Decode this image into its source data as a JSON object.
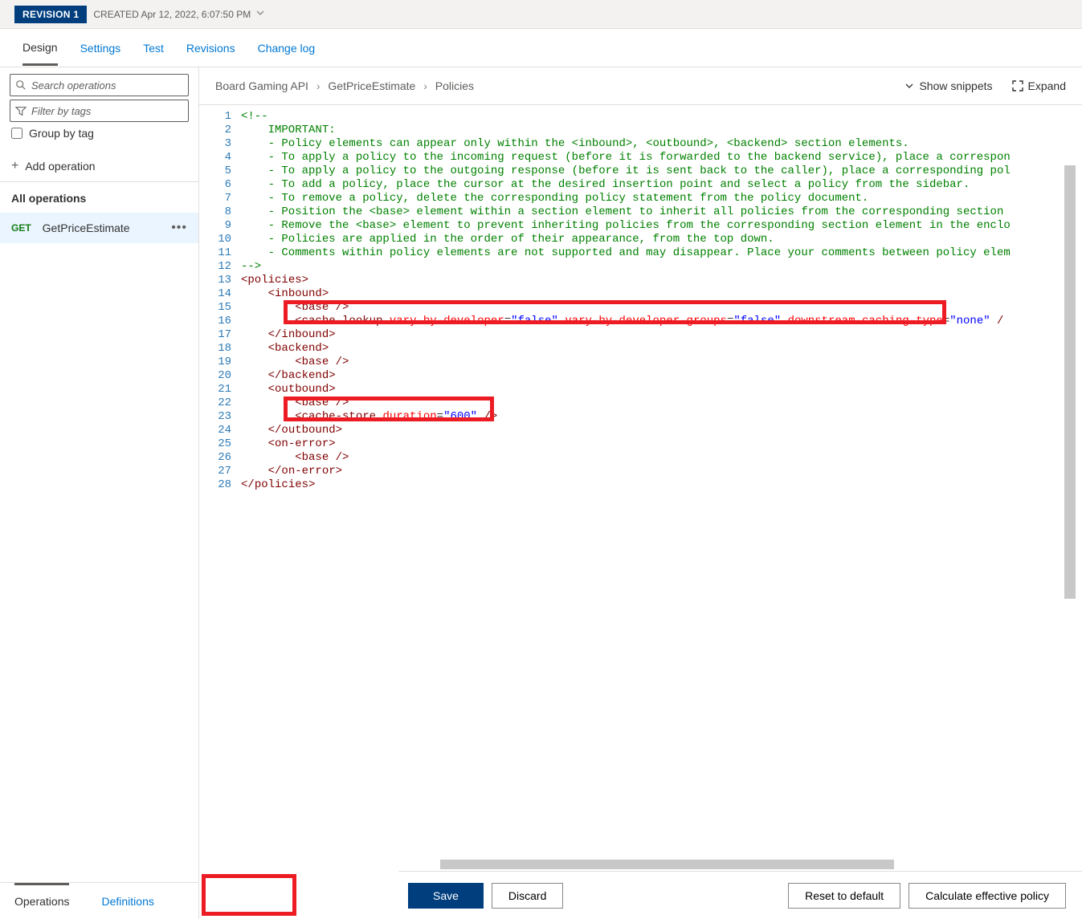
{
  "revision": {
    "badge": "REVISION 1",
    "created_label": "CREATED",
    "created_at": "Apr 12, 2022, 6:07:50 PM"
  },
  "top_tabs": [
    "Design",
    "Settings",
    "Test",
    "Revisions",
    "Change log"
  ],
  "top_tab_active": 0,
  "left": {
    "search_placeholder": "Search operations",
    "filter_placeholder": "Filter by tags",
    "group_by_tag": "Group by tag",
    "add_operation": "Add operation",
    "all_operations": "All operations",
    "operation": {
      "method": "GET",
      "name": "GetPriceEstimate"
    },
    "bottom_tabs": [
      "Operations",
      "Definitions"
    ],
    "bottom_active": 0
  },
  "breadcrumb": [
    "Board Gaming API",
    "GetPriceEstimate",
    "Policies"
  ],
  "right_actions": {
    "show_snippets": "Show snippets",
    "expand": "Expand"
  },
  "code_lines": [
    {
      "n": 1,
      "segs": [
        {
          "c": "cm",
          "t": "<!--"
        }
      ]
    },
    {
      "n": 2,
      "segs": [
        {
          "c": "cm",
          "t": "    IMPORTANT:"
        }
      ]
    },
    {
      "n": 3,
      "segs": [
        {
          "c": "cm",
          "t": "    - Policy elements can appear only within the <inbound>, <outbound>, <backend> section elements."
        }
      ]
    },
    {
      "n": 4,
      "segs": [
        {
          "c": "cm",
          "t": "    - To apply a policy to the incoming request (before it is forwarded to the backend service), place a correspon"
        }
      ]
    },
    {
      "n": 5,
      "segs": [
        {
          "c": "cm",
          "t": "    - To apply a policy to the outgoing response (before it is sent back to the caller), place a corresponding pol"
        }
      ]
    },
    {
      "n": 6,
      "segs": [
        {
          "c": "cm",
          "t": "    - To add a policy, place the cursor at the desired insertion point and select a policy from the sidebar."
        }
      ]
    },
    {
      "n": 7,
      "segs": [
        {
          "c": "cm",
          "t": "    - To remove a policy, delete the corresponding policy statement from the policy document."
        }
      ]
    },
    {
      "n": 8,
      "segs": [
        {
          "c": "cm",
          "t": "    - Position the <base> element within a section element to inherit all policies from the corresponding section "
        }
      ]
    },
    {
      "n": 9,
      "segs": [
        {
          "c": "cm",
          "t": "    - Remove the <base> element to prevent inheriting policies from the corresponding section element in the enclo"
        }
      ]
    },
    {
      "n": 10,
      "segs": [
        {
          "c": "cm",
          "t": "    - Policies are applied in the order of their appearance, from the top down."
        }
      ]
    },
    {
      "n": 11,
      "segs": [
        {
          "c": "cm",
          "t": "    - Comments within policy elements are not supported and may disappear. Place your comments between policy elem"
        }
      ]
    },
    {
      "n": 12,
      "segs": [
        {
          "c": "cm",
          "t": "-->"
        }
      ]
    },
    {
      "n": 13,
      "segs": [
        {
          "c": "tag-p",
          "t": "<"
        },
        {
          "c": "tag-n",
          "t": "policies"
        },
        {
          "c": "tag-p",
          "t": ">"
        }
      ]
    },
    {
      "n": 14,
      "segs": [
        {
          "t": "    "
        },
        {
          "c": "tag-p",
          "t": "<"
        },
        {
          "c": "tag-n",
          "t": "inbound"
        },
        {
          "c": "tag-p",
          "t": ">"
        }
      ]
    },
    {
      "n": 15,
      "segs": [
        {
          "t": "        "
        },
        {
          "c": "tag-p",
          "t": "<"
        },
        {
          "c": "tag-n",
          "t": "base"
        },
        {
          "t": " "
        },
        {
          "c": "tag-p",
          "t": "/>"
        }
      ]
    },
    {
      "n": 16,
      "segs": [
        {
          "t": "        "
        },
        {
          "c": "tag-p",
          "t": "<"
        },
        {
          "c": "tag-n",
          "t": "cache-lookup"
        },
        {
          "t": " "
        },
        {
          "c": "attr-n",
          "t": "vary-by-developer"
        },
        {
          "c": "eq",
          "t": "="
        },
        {
          "c": "attr-v",
          "t": "\"false\""
        },
        {
          "t": " "
        },
        {
          "c": "attr-n",
          "t": "vary-by-developer-groups"
        },
        {
          "c": "eq",
          "t": "="
        },
        {
          "c": "attr-v",
          "t": "\"false\""
        },
        {
          "t": " "
        },
        {
          "c": "attr-n",
          "t": "downstream-caching-type"
        },
        {
          "c": "eq",
          "t": "="
        },
        {
          "c": "attr-v",
          "t": "\"none\""
        },
        {
          "t": " "
        },
        {
          "c": "tag-p",
          "t": "/"
        }
      ]
    },
    {
      "n": 17,
      "segs": [
        {
          "t": "    "
        },
        {
          "c": "tag-p",
          "t": "</"
        },
        {
          "c": "tag-n",
          "t": "inbound"
        },
        {
          "c": "tag-p",
          "t": ">"
        }
      ]
    },
    {
      "n": 18,
      "segs": [
        {
          "t": "    "
        },
        {
          "c": "tag-p",
          "t": "<"
        },
        {
          "c": "tag-n",
          "t": "backend"
        },
        {
          "c": "tag-p",
          "t": ">"
        }
      ]
    },
    {
      "n": 19,
      "segs": [
        {
          "t": "        "
        },
        {
          "c": "tag-p",
          "t": "<"
        },
        {
          "c": "tag-n",
          "t": "base"
        },
        {
          "t": " "
        },
        {
          "c": "tag-p",
          "t": "/>"
        }
      ]
    },
    {
      "n": 20,
      "segs": [
        {
          "t": "    "
        },
        {
          "c": "tag-p",
          "t": "</"
        },
        {
          "c": "tag-n",
          "t": "backend"
        },
        {
          "c": "tag-p",
          "t": ">"
        }
      ]
    },
    {
      "n": 21,
      "segs": [
        {
          "t": "    "
        },
        {
          "c": "tag-p",
          "t": "<"
        },
        {
          "c": "tag-n",
          "t": "outbound"
        },
        {
          "c": "tag-p",
          "t": ">"
        }
      ]
    },
    {
      "n": 22,
      "segs": [
        {
          "t": "        "
        },
        {
          "c": "tag-p",
          "t": "<"
        },
        {
          "c": "tag-n",
          "t": "base"
        },
        {
          "t": " "
        },
        {
          "c": "tag-p",
          "t": "/>"
        }
      ]
    },
    {
      "n": 23,
      "segs": [
        {
          "t": "        "
        },
        {
          "c": "tag-p",
          "t": "<"
        },
        {
          "c": "tag-n",
          "t": "cache-store"
        },
        {
          "t": " "
        },
        {
          "c": "attr-n",
          "t": "duration"
        },
        {
          "c": "eq",
          "t": "="
        },
        {
          "c": "attr-v",
          "t": "\"600\""
        },
        {
          "t": " "
        },
        {
          "c": "tag-p",
          "t": "/>"
        }
      ]
    },
    {
      "n": 24,
      "segs": [
        {
          "t": "    "
        },
        {
          "c": "tag-p",
          "t": "</"
        },
        {
          "c": "tag-n",
          "t": "outbound"
        },
        {
          "c": "tag-p",
          "t": ">"
        }
      ]
    },
    {
      "n": 25,
      "segs": [
        {
          "t": "    "
        },
        {
          "c": "tag-p",
          "t": "<"
        },
        {
          "c": "tag-n",
          "t": "on-error"
        },
        {
          "c": "tag-p",
          "t": ">"
        }
      ]
    },
    {
      "n": 26,
      "segs": [
        {
          "t": "        "
        },
        {
          "c": "tag-p",
          "t": "<"
        },
        {
          "c": "tag-n",
          "t": "base"
        },
        {
          "t": " "
        },
        {
          "c": "tag-p",
          "t": "/>"
        }
      ]
    },
    {
      "n": 27,
      "segs": [
        {
          "t": "    "
        },
        {
          "c": "tag-p",
          "t": "</"
        },
        {
          "c": "tag-n",
          "t": "on-error"
        },
        {
          "c": "tag-p",
          "t": ">"
        }
      ]
    },
    {
      "n": 28,
      "segs": [
        {
          "c": "tag-p",
          "t": "</"
        },
        {
          "c": "tag-n",
          "t": "policies"
        },
        {
          "c": "tag-p",
          "t": ">"
        }
      ]
    }
  ],
  "bottom": {
    "save": "Save",
    "discard": "Discard",
    "reset": "Reset to default",
    "calc": "Calculate effective policy"
  }
}
